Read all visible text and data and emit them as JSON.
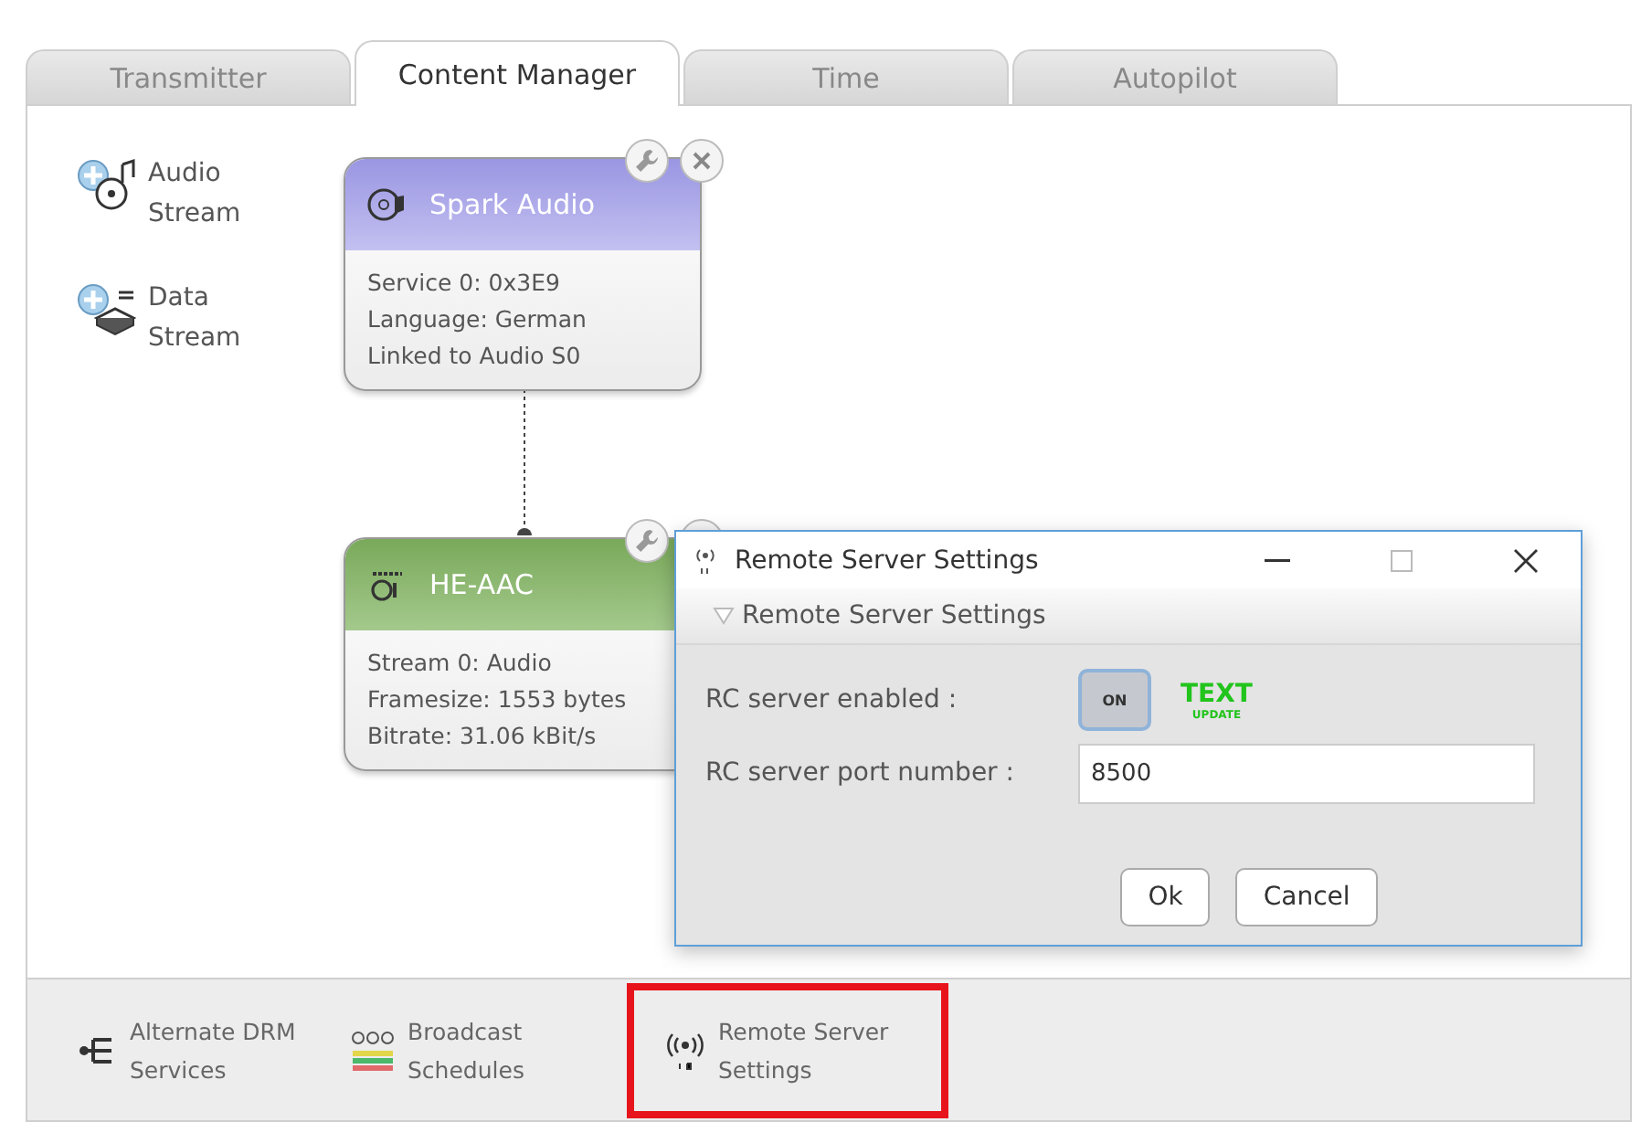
{
  "tabs": [
    {
      "label": "Transmitter",
      "selected": false
    },
    {
      "label": "Content Manager",
      "selected": true
    },
    {
      "label": "Time",
      "selected": false
    },
    {
      "label": "Autopilot",
      "selected": false
    }
  ],
  "palette": [
    {
      "kind": "audio",
      "label": "Audio Stream"
    },
    {
      "kind": "data",
      "label": "Data Stream"
    }
  ],
  "nodes": [
    {
      "kind": "service",
      "title": "Spark Audio",
      "lines": [
        "Service 0: 0x3E9",
        "Language: German",
        "Linked to Audio S0"
      ]
    },
    {
      "kind": "codec",
      "title": "HE-AAC",
      "lines": [
        "Stream 0: Audio",
        "Framesize: 1553 bytes",
        "Bitrate: 31.06 kBit/s"
      ]
    }
  ],
  "dialog": {
    "title": "Remote Server Settings",
    "section": {
      "label": "Remote Server Settings",
      "expanded": true
    },
    "fields": [
      {
        "kind": "toggle",
        "label": "RC server enabled :",
        "value": "ON",
        "on": true,
        "badge": {
          "top": "TEXT",
          "bottom": "UPDATE"
        }
      },
      {
        "kind": "text",
        "label": "RC server port number :",
        "value": "8500"
      }
    ],
    "buttons": [
      "Ok",
      "Cancel"
    ]
  },
  "bottom_bar": [
    {
      "kind": "alternate",
      "label": "Alternate DRM Services",
      "highlighted": false
    },
    {
      "kind": "schedule",
      "label": "Broadcast Schedules",
      "highlighted": false
    },
    {
      "kind": "remote",
      "label": "Remote Server Settings",
      "highlighted": true
    }
  ]
}
